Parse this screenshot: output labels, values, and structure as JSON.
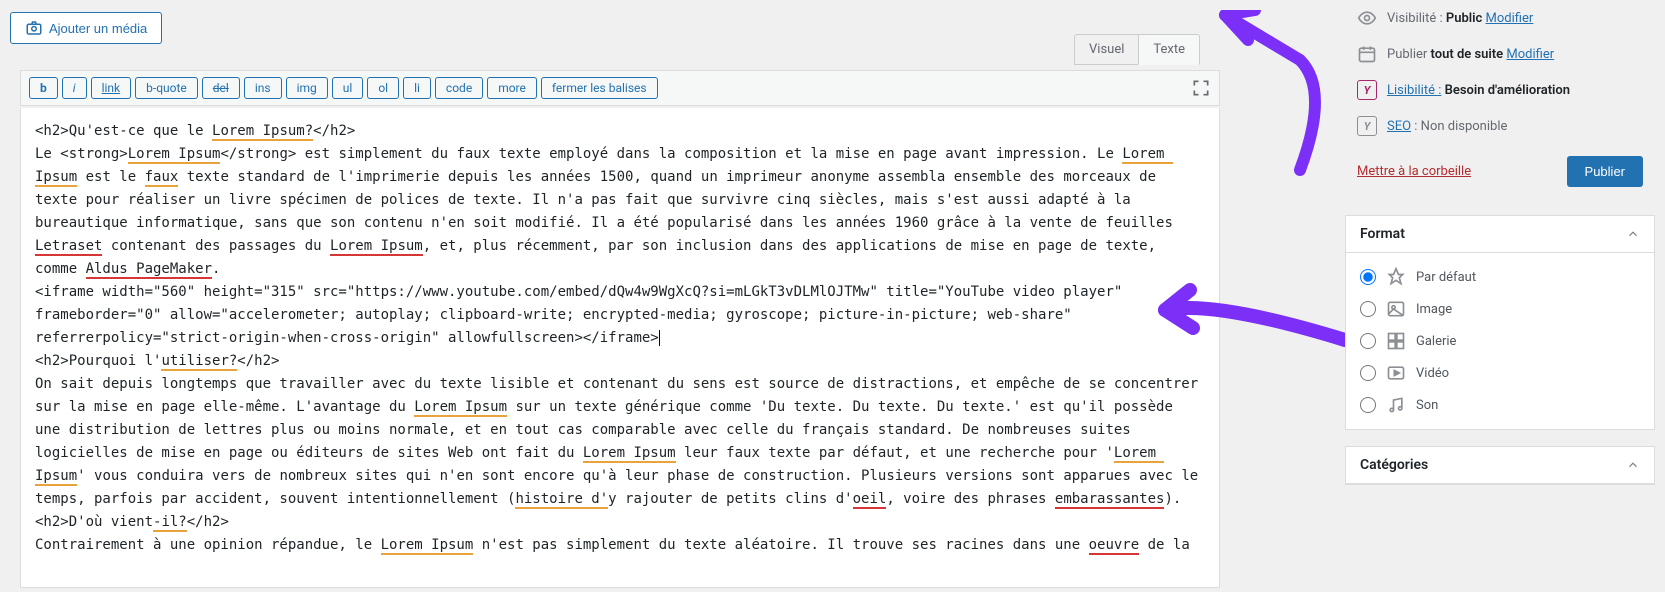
{
  "media_button": "Ajouter un média",
  "tabs": {
    "visual": "Visuel",
    "text": "Texte"
  },
  "quicktags": {
    "b": "b",
    "i": "i",
    "link": "link",
    "bquote": "b-quote",
    "del": "del",
    "ins": "ins",
    "img": "img",
    "ul": "ul",
    "ol": "ol",
    "li": "li",
    "code": "code",
    "more": "more",
    "close": "fermer les balises"
  },
  "content": {
    "h2_1_open": "<h2>Qu'est-ce que le ",
    "h2_1_term": "Lorem Ipsum?",
    "h2_1_close": "</h2>",
    "p1_a": "Le <strong>",
    "p1_li1": "Lorem Ipsum",
    "p1_b": "</strong> est simplement du faux texte employé dans la composition et la mise en page avant impression. Le ",
    "p1_li2": "Lorem Ipsum",
    "p1_c": " est le ",
    "p1_faux": "faux",
    "p1_d": " texte standard de l'imprimerie depuis les années 1500, quand un imprimeur anonyme assembla ensemble des morceaux de texte pour réaliser un livre spécimen de polices de texte. Il n'a pas fait que survivre cinq siècles, mais s'est aussi adapté à la bureautique informatique, sans que son contenu n'en soit modifié. Il a été popularisé dans les années 1960 grâce à la vente de feuilles ",
    "p1_letra": "Letraset",
    "p1_e": " contenant des passages du ",
    "p1_li3": "Lorem Ipsum",
    "p1_f": ", et, plus récemment, par son inclusion dans des applications de mise en page de texte, comme ",
    "p1_aldus": "Aldus PageMaker",
    "p1_g": ".",
    "iframe": "<iframe width=\"560\" height=\"315\" src=\"https://www.youtube.com/embed/dQw4w9WgXcQ?si=mLGkT3vDLMlOJTMw\" title=\"YouTube video player\" frameborder=\"0\" allow=\"accelerometer; autoplay; clipboard-write; encrypted-media; gyroscope; picture-in-picture; web-share\" referrerpolicy=\"strict-origin-when-cross-origin\" allowfullscreen></iframe>",
    "h2_2_open": "<h2>Pourquoi l'",
    "h2_2_term": "utiliser?",
    "h2_2_close": "</h2>",
    "p2_a": "On sait depuis longtemps que travailler avec du texte lisible et contenant du sens est source de distractions, et empêche de se concentrer sur la mise en page elle-même. L'avantage du ",
    "p2_li1": "Lorem Ipsum",
    "p2_b": " sur un texte générique comme 'Du texte. Du texte. Du texte.' est qu'il possède une distribution de lettres plus ou moins normale, et en tout cas comparable avec celle du français standard. De nombreuses suites logicielles de mise en page ou éditeurs de sites Web ont fait du ",
    "p2_li2": "Lorem Ipsum",
    "p2_c": " leur faux texte par défaut, et une recherche pour '",
    "p2_li3": "Lorem Ipsum",
    "p2_d": "' vous conduira vers de nombreux sites qui n'en sont encore qu'à leur phase de construction. Plusieurs versions sont apparues avec le temps, parfois par accident, souvent intentionnellement (",
    "p2_hist": "histoire d'",
    "p2_e": "y rajouter de petits clins d'",
    "p2_oeil": "oeil",
    "p2_f": ", voire des phrases ",
    "p2_emb": "embarassantes",
    "p2_g": ").",
    "h2_3_open": "<h2>D'où vient",
    "h2_3_term": "-il?",
    "h2_3_close": "</h2>",
    "p3_a": "Contrairement à une opinion répandue, le ",
    "p3_li1": "Lorem Ipsum",
    "p3_b": " n'est pas simplement du texte aléatoire. Il trouve ses racines dans une ",
    "p3_oeuvre": "oeuvre",
    "p3_c": " de la"
  },
  "sidebar": {
    "visibility": {
      "label": "Visibilité :",
      "value": "Public",
      "edit": "Modifier"
    },
    "publish": {
      "label": "Publier",
      "value": "tout de suite",
      "edit": "Modifier"
    },
    "readability": {
      "label": "Lisibilité :",
      "value": "Besoin d'amélioration"
    },
    "seo": {
      "label": "SEO",
      "value": ": Non disponible"
    },
    "trash": "Mettre à la corbeille",
    "publish_btn": "Publier"
  },
  "format": {
    "title": "Format",
    "options": {
      "default": "Par défaut",
      "image": "Image",
      "gallery": "Galerie",
      "video": "Vidéo",
      "audio": "Son"
    }
  },
  "categories": {
    "title": "Catégories"
  }
}
